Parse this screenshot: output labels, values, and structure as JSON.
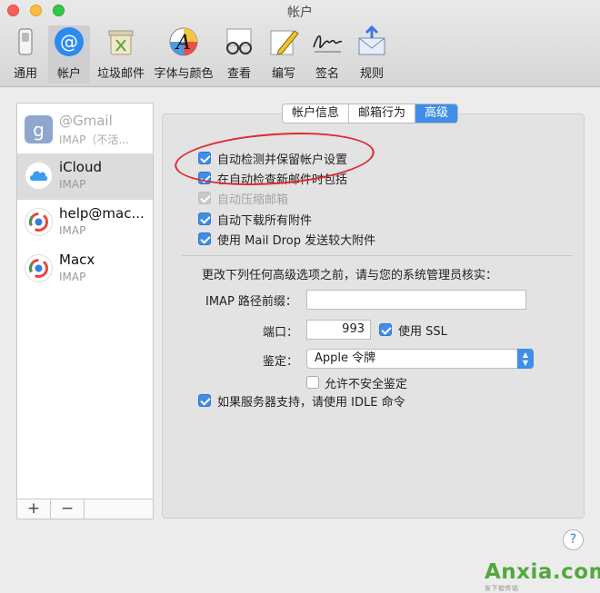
{
  "window": {
    "title": "帐户"
  },
  "toolbar": [
    {
      "label": "通用",
      "icon": "switch-icon"
    },
    {
      "label": "帐户",
      "icon": "at-sign-icon"
    },
    {
      "label": "垃圾邮件",
      "icon": "trash-bin-icon"
    },
    {
      "label": "字体与颜色",
      "icon": "font-color-icon"
    },
    {
      "label": "查看",
      "icon": "glasses-icon"
    },
    {
      "label": "编写",
      "icon": "pencil-icon"
    },
    {
      "label": "签名",
      "icon": "signature-icon"
    },
    {
      "label": "规则",
      "icon": "rules-envelope-icon"
    }
  ],
  "sidebar": {
    "accounts": [
      {
        "name": "@Gmail",
        "type": "IMAP（不活...",
        "icon": "gmail-g-icon"
      },
      {
        "name": "iCloud",
        "type": "IMAP",
        "icon": "icloud-icon"
      },
      {
        "name": "help@mac...",
        "type": "IMAP",
        "icon": "mail-account-icon"
      },
      {
        "name": "Macx",
        "type": "IMAP",
        "icon": "mail-account-icon"
      }
    ],
    "add_label": "+",
    "remove_label": "−"
  },
  "tabs": [
    {
      "label": "帐户信息",
      "active": false
    },
    {
      "label": "邮箱行为",
      "active": false
    },
    {
      "label": "高级",
      "active": true
    }
  ],
  "options": {
    "auto_detect": {
      "label": "自动检测并保留帐户设置",
      "checked": true
    },
    "include_in_check": {
      "label": "在自动检查新邮件时包括",
      "checked": true
    },
    "auto_compact": {
      "label": "自动压缩邮箱",
      "checked": true,
      "disabled": true
    },
    "auto_download": {
      "label": "自动下载所有附件",
      "checked": true
    },
    "mail_drop": {
      "label": "使用 Mail Drop 发送较大附件",
      "checked": true
    }
  },
  "advanced": {
    "note": "更改下列任何高级选项之前，请与您的系统管理员核实：",
    "imap_prefix_label": "IMAP 路径前缀：",
    "imap_prefix_value": "",
    "port_label": "端口：",
    "port_value": "993",
    "ssl_label": "使用 SSL",
    "auth_label": "鉴定：",
    "auth_value": "Apple 令牌",
    "allow_insecure_label": "允许不安全鉴定",
    "idle_label": "如果服务器支持，请使用 IDLE 命令"
  },
  "help_label": "?",
  "watermark": {
    "text": "Anxia.com",
    "sub": "安下软件站"
  },
  "colors": {
    "accent": "#3f8ee8",
    "annotation": "#e0272f"
  }
}
